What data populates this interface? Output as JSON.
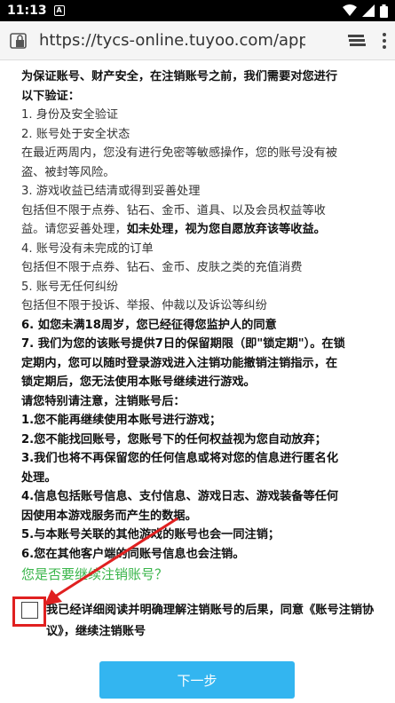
{
  "status_bar": {
    "time": "11:13",
    "notif": "A"
  },
  "browser": {
    "url": "https://tycs-online.tuyoo.com/appCa"
  },
  "content": {
    "lines": [
      {
        "text": "为保证账号、财产安全，在注销账号之前，我们需要对您进行",
        "style": "b"
      },
      {
        "text": "以下验证：",
        "style": "b"
      },
      {
        "text": "1. 身份及安全验证",
        "style": "n"
      },
      {
        "text": "2. 账号处于安全状态",
        "style": "n"
      },
      {
        "text": "在最近两周内，您没有进行免密等敏感操作，您的账号没有被",
        "style": "n"
      },
      {
        "text": "盗、被封等风险。",
        "style": "n"
      },
      {
        "text": "3. 游戏收益已结清或得到妥善处理",
        "style": "n"
      },
      {
        "text": "包括但不限于点券、钻石、金币、道具、以及会员权益等收",
        "style": "n"
      },
      {
        "text": "益。请您妥善处理，如未处理，视为您自愿放弃该等收益。",
        "style": "mixed"
      },
      {
        "text": "4. 账号没有未完成的订单",
        "style": "n"
      },
      {
        "text": "包括但不限于点券、钻石、金币、皮肤之类的充值消费",
        "style": "n"
      },
      {
        "text": "5. 账号无任何纠纷",
        "style": "n"
      },
      {
        "text": "包括但不限于投诉、举报、仲裁以及诉讼等纠纷",
        "style": "n"
      },
      {
        "text": "6. 如您未满18周岁，您已经征得您监护人的同意",
        "style": "b"
      },
      {
        "text": "7. 我们为您的该账号提供7日的保留期限（即\"锁定期\"）。在锁",
        "style": "b"
      },
      {
        "text": "定期内，您可以随时登录游戏进入注销功能撤销注销指示，在",
        "style": "b"
      },
      {
        "text": "锁定期后，您无法使用本账号继续进行游戏。",
        "style": "b"
      },
      {
        "text": "请您特别请注意，注销账号后：",
        "style": "b"
      },
      {
        "text": "1.您不能再继续使用本账号进行游戏；",
        "style": "b"
      },
      {
        "text": "2.您不能找回账号，您账号下的任何权益视为您自动放弃；",
        "style": "b"
      },
      {
        "text": "3.我们也将不再保留您的任何信息或将对您的信息进行匿名化",
        "style": "b"
      },
      {
        "text": "处理。",
        "style": "b"
      },
      {
        "text": "4.信息包括账号信息、支付信息、游戏日志、游戏装备等任何",
        "style": "b"
      },
      {
        "text": "因使用本游戏服务而产生的数据。",
        "style": "b"
      },
      {
        "text": "5.与本账号关联的其他游戏的账号也会一同注销；",
        "style": "b"
      },
      {
        "text": "6.您在其他客户端的同账号信息也会注销。",
        "style": "b"
      }
    ],
    "mixed_normal": "益。请您妥善处理，",
    "mixed_bold": "如未处理，视为您自愿放弃该等收益。",
    "question": "您是否要继续注销账号？"
  },
  "agreement": {
    "text": "我已经详细阅读并明确理解注销账号的后果，同意《账号注销协议》，继续注销账号"
  },
  "next_button": {
    "label": "下一步"
  },
  "colors": {
    "accent_green": "#39b54a",
    "button_blue": "#33b5f0",
    "highlight_red": "#e02020"
  }
}
